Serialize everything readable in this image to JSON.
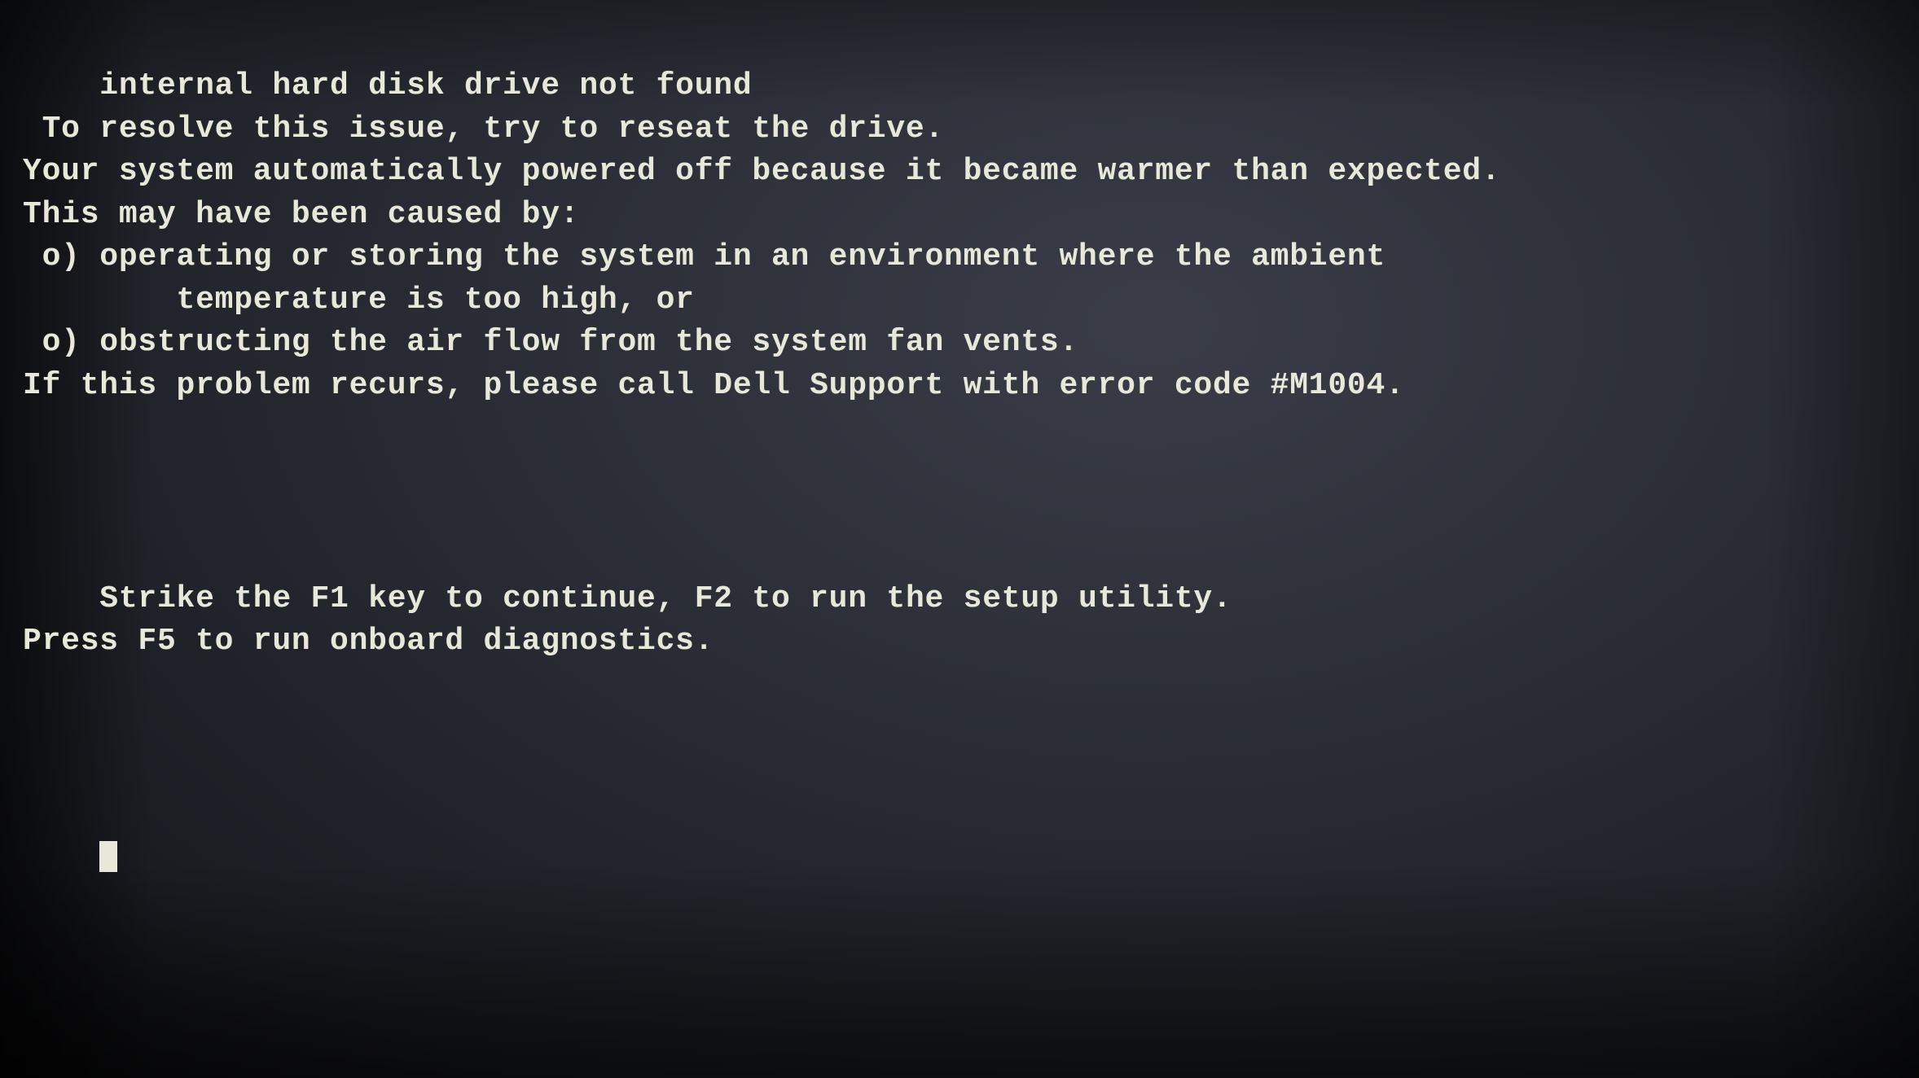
{
  "screen": {
    "lines": [
      "internal hard disk drive not found",
      " To resolve this issue, try to reseat the drive.",
      "Your system automatically powered off because it became warmer than expected.",
      "This may have been caused by:",
      " o) operating or storing the system in an environment where the ambient",
      "        temperature is too high, or",
      " o) obstructing the air flow from the system fan vents.",
      "If this problem recurs, please call Dell Support with error code #M1004.",
      "",
      "Strike the F1 key to continue, F2 to run the setup utility.",
      "Press F5 to run onboard diagnostics.",
      ""
    ],
    "cursor_visible": true
  }
}
